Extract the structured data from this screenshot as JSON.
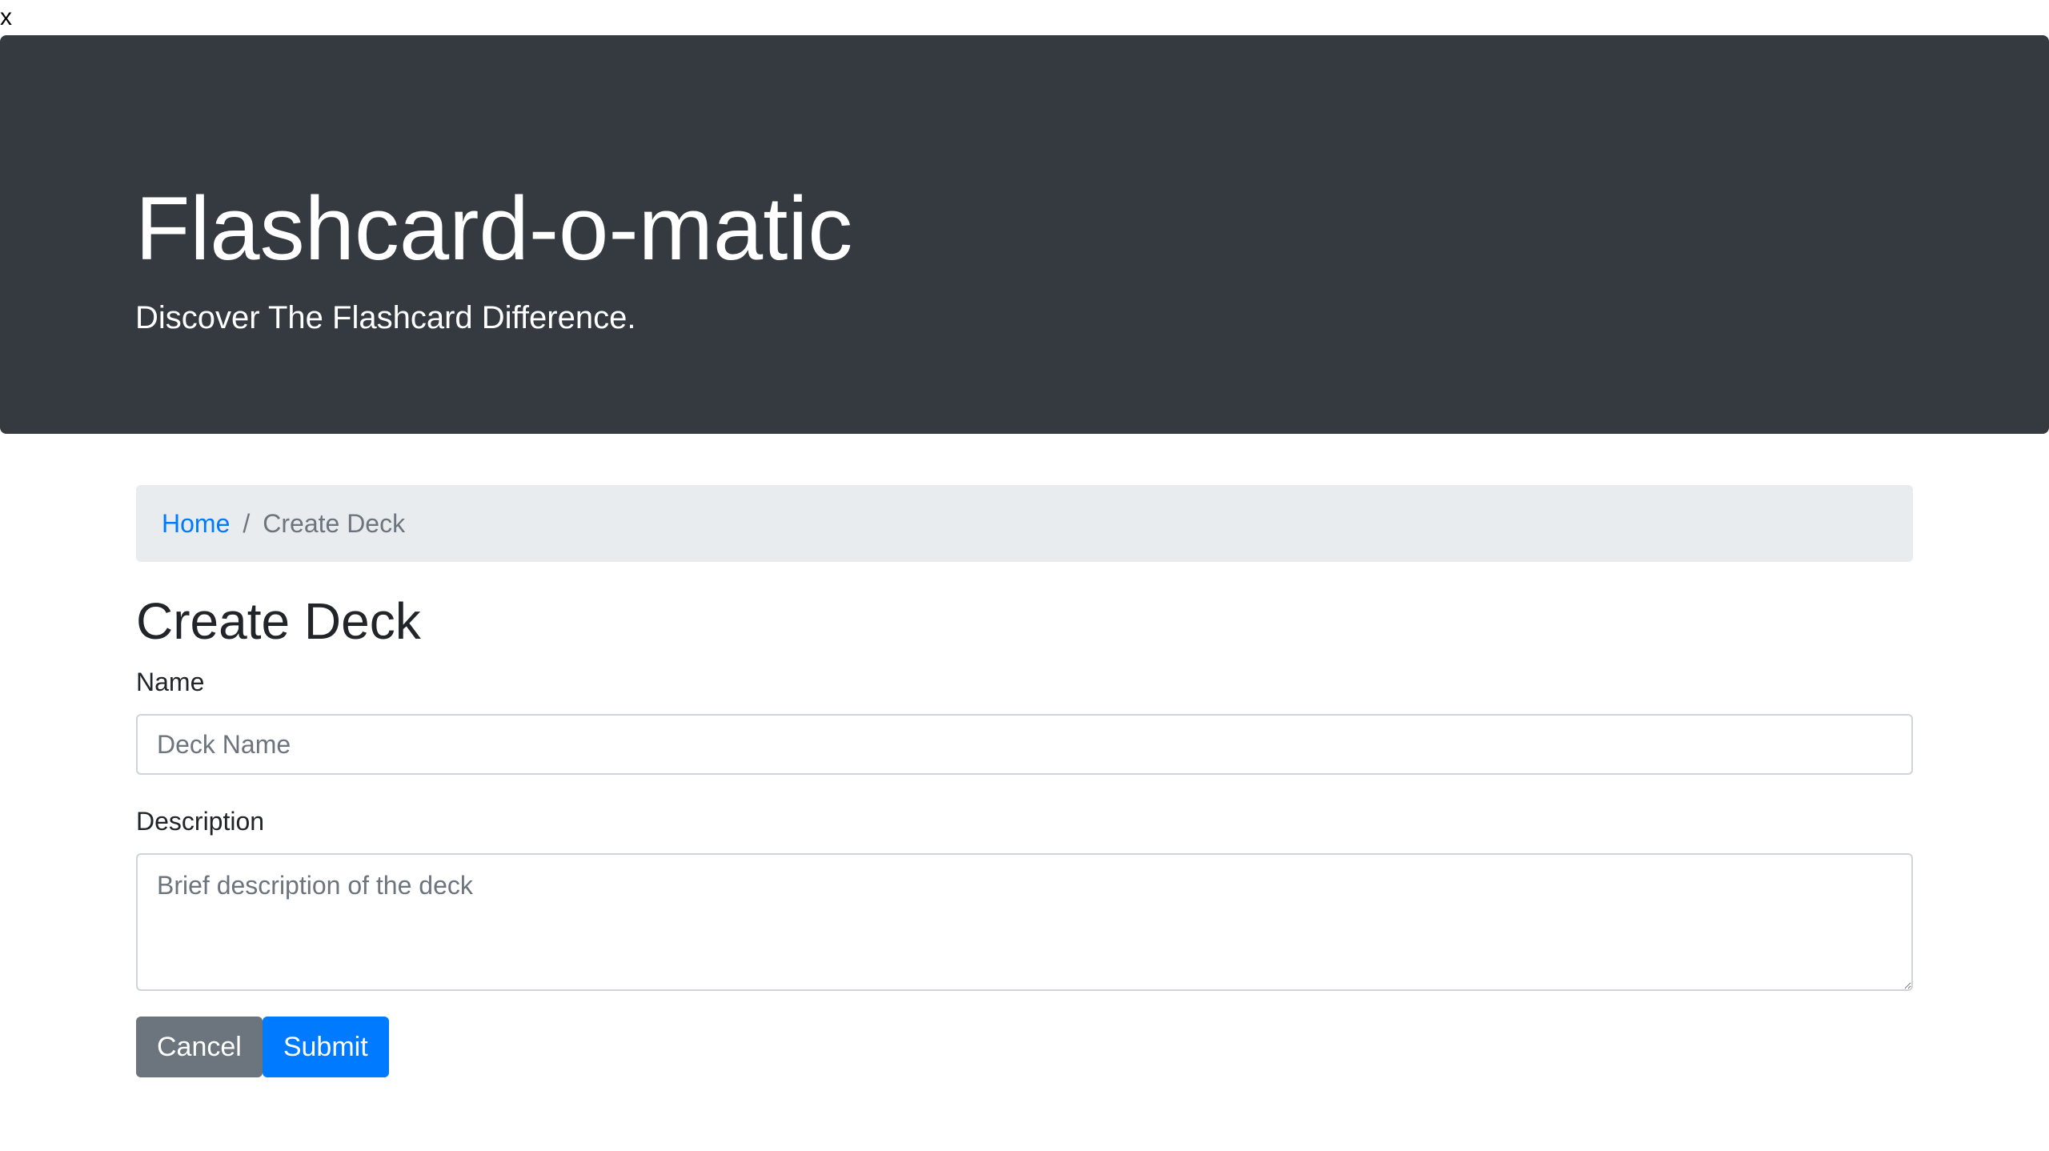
{
  "top_text": "x",
  "header": {
    "title": "Flashcard-o-matic",
    "lead": "Discover The Flashcard Difference."
  },
  "breadcrumb": {
    "home": "Home",
    "separator": "/",
    "current": "Create Deck"
  },
  "page": {
    "title": "Create Deck"
  },
  "form": {
    "name_label": "Name",
    "name_placeholder": "Deck Name",
    "description_label": "Description",
    "description_placeholder": "Brief description of the deck",
    "cancel_label": "Cancel",
    "submit_label": "Submit"
  },
  "colors": {
    "header_bg": "#343a40",
    "breadcrumb_bg": "#e9ecef",
    "link": "#007bff",
    "secondary_button": "#6c757d",
    "primary_button": "#007bff"
  }
}
